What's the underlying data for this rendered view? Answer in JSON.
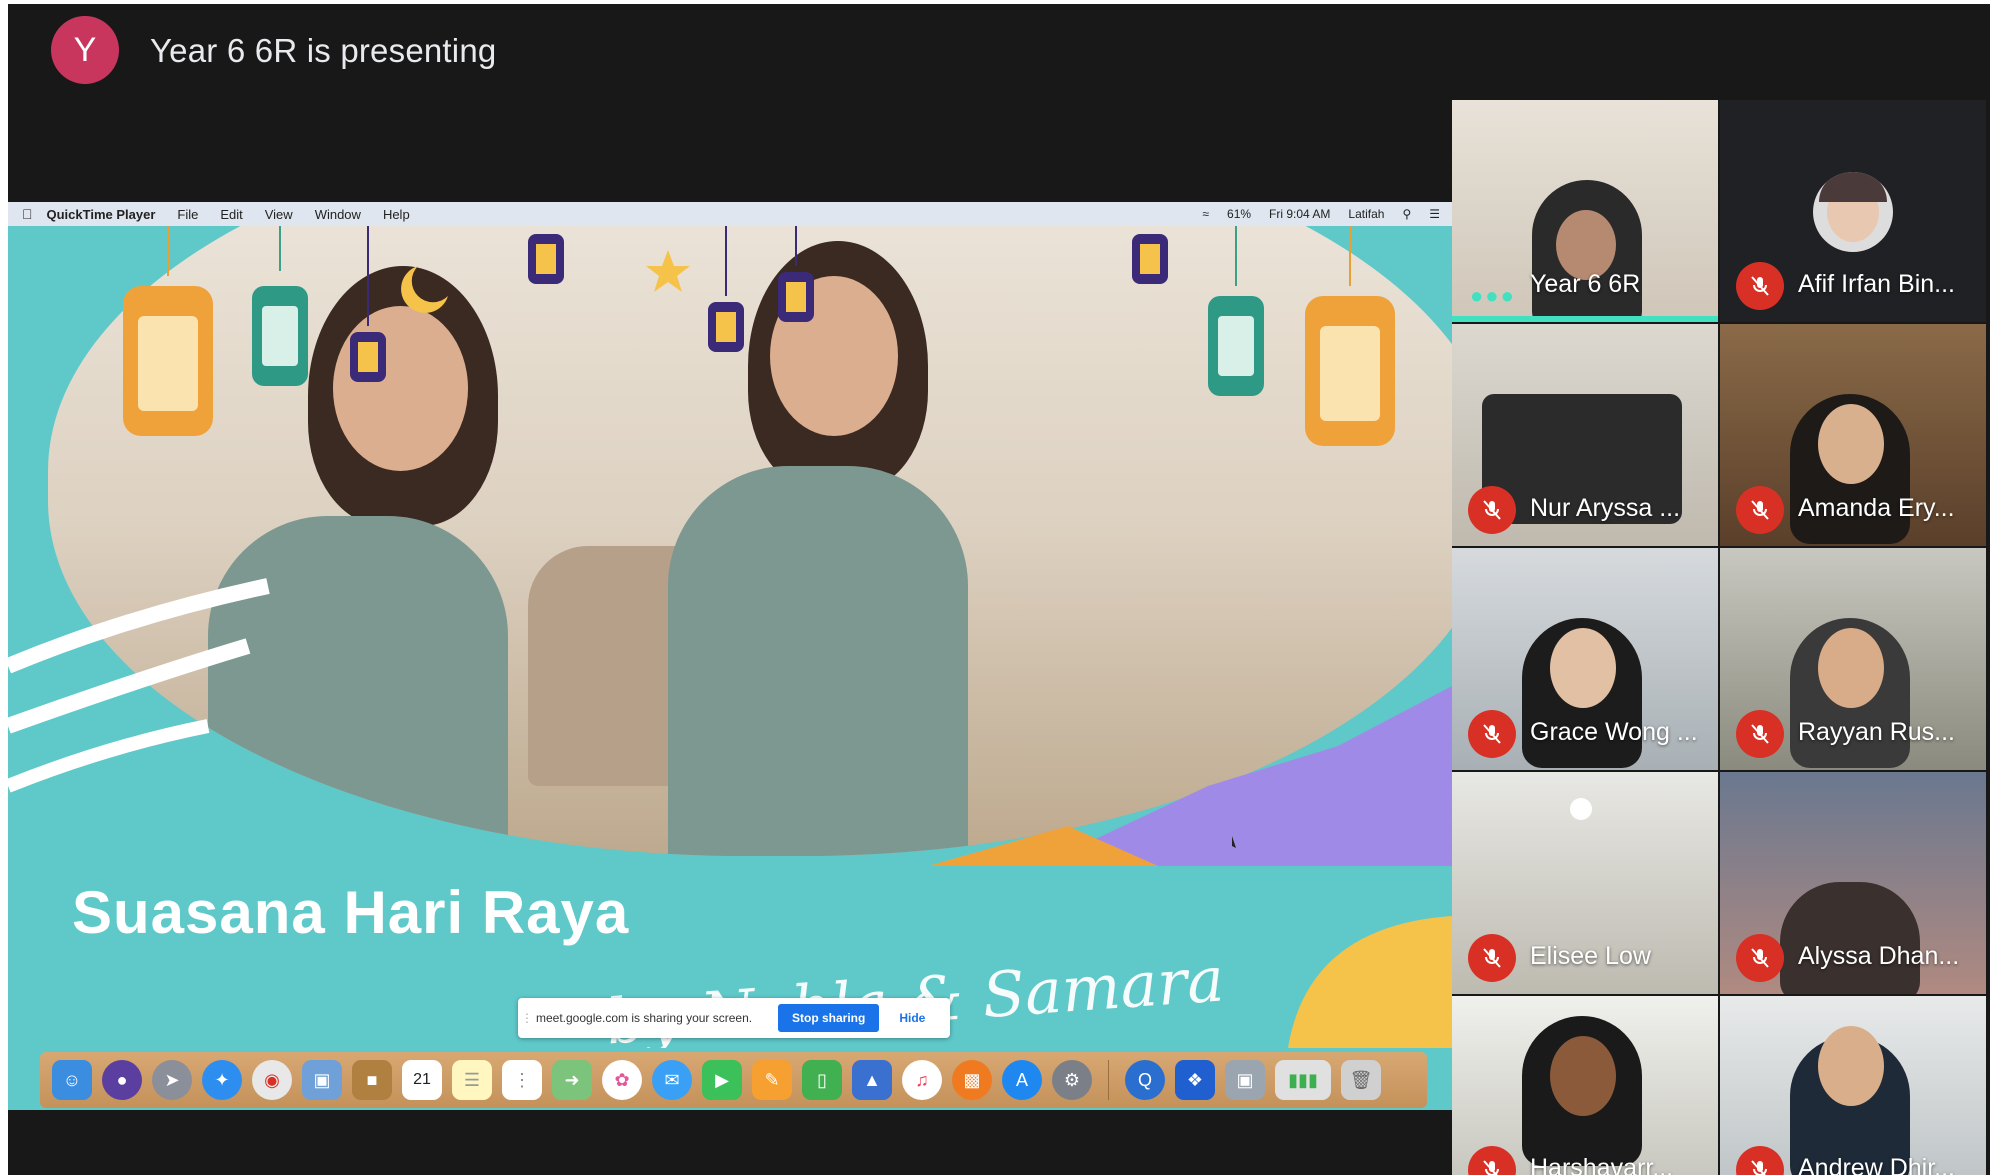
{
  "presenter": {
    "avatar_letter": "Y",
    "avatar_color": "#c8365e",
    "text": "Year 6 6R is presenting"
  },
  "menubar": {
    "app_name": "QuickTime Player",
    "menus": [
      "File",
      "Edit",
      "View",
      "Window",
      "Help"
    ],
    "battery": "61%",
    "clock": "Fri 9:04 AM",
    "user": "Latifah"
  },
  "slide": {
    "title": "Suasana Hari Raya",
    "subtitle": "by Nahla & Samara Savory"
  },
  "sharing_bar": {
    "message": "meet.google.com is sharing your screen.",
    "stop_label": "Stop sharing",
    "hide_label": "Hide"
  },
  "dock": {
    "calendar_day": "21",
    "icons": [
      "finder-icon",
      "siri-icon",
      "launchpad-icon",
      "safari-icon",
      "chrome-icon",
      "preview-icon",
      "folder-icon",
      "calendar-icon",
      "notes-icon",
      "reminders-icon",
      "maps-icon",
      "photos-icon",
      "messages-icon",
      "facetime-icon",
      "pages-icon",
      "numbers-icon",
      "keynote-icon",
      "music-icon",
      "books-icon",
      "app-store-icon",
      "system-preferences-icon",
      "quicktime-icon",
      "dropbox-icon",
      "screenshot-icon",
      "battery-app-icon",
      "trash-icon"
    ]
  },
  "participants": [
    {
      "name": "Year 6 6R",
      "muted": false,
      "speaking": true
    },
    {
      "name": "Afif Irfan Bin...",
      "muted": true
    },
    {
      "name": "Nur Aryssa ...",
      "muted": true
    },
    {
      "name": "Amanda Ery...",
      "muted": true
    },
    {
      "name": "Grace Wong ...",
      "muted": true
    },
    {
      "name": "Rayyan Rus...",
      "muted": true
    },
    {
      "name": "Elisee Low",
      "muted": true
    },
    {
      "name": "Alyssa Dhan...",
      "muted": true
    },
    {
      "name": "Harshavarr...",
      "muted": true
    },
    {
      "name": "Andrew Dhir...",
      "muted": true
    }
  ],
  "colors": {
    "meeting_bg": "#181818",
    "slide_teal": "#5fc8c9",
    "mute_red": "#d93025",
    "speaking_teal": "#40e0c0",
    "google_blue": "#1a73e8"
  }
}
